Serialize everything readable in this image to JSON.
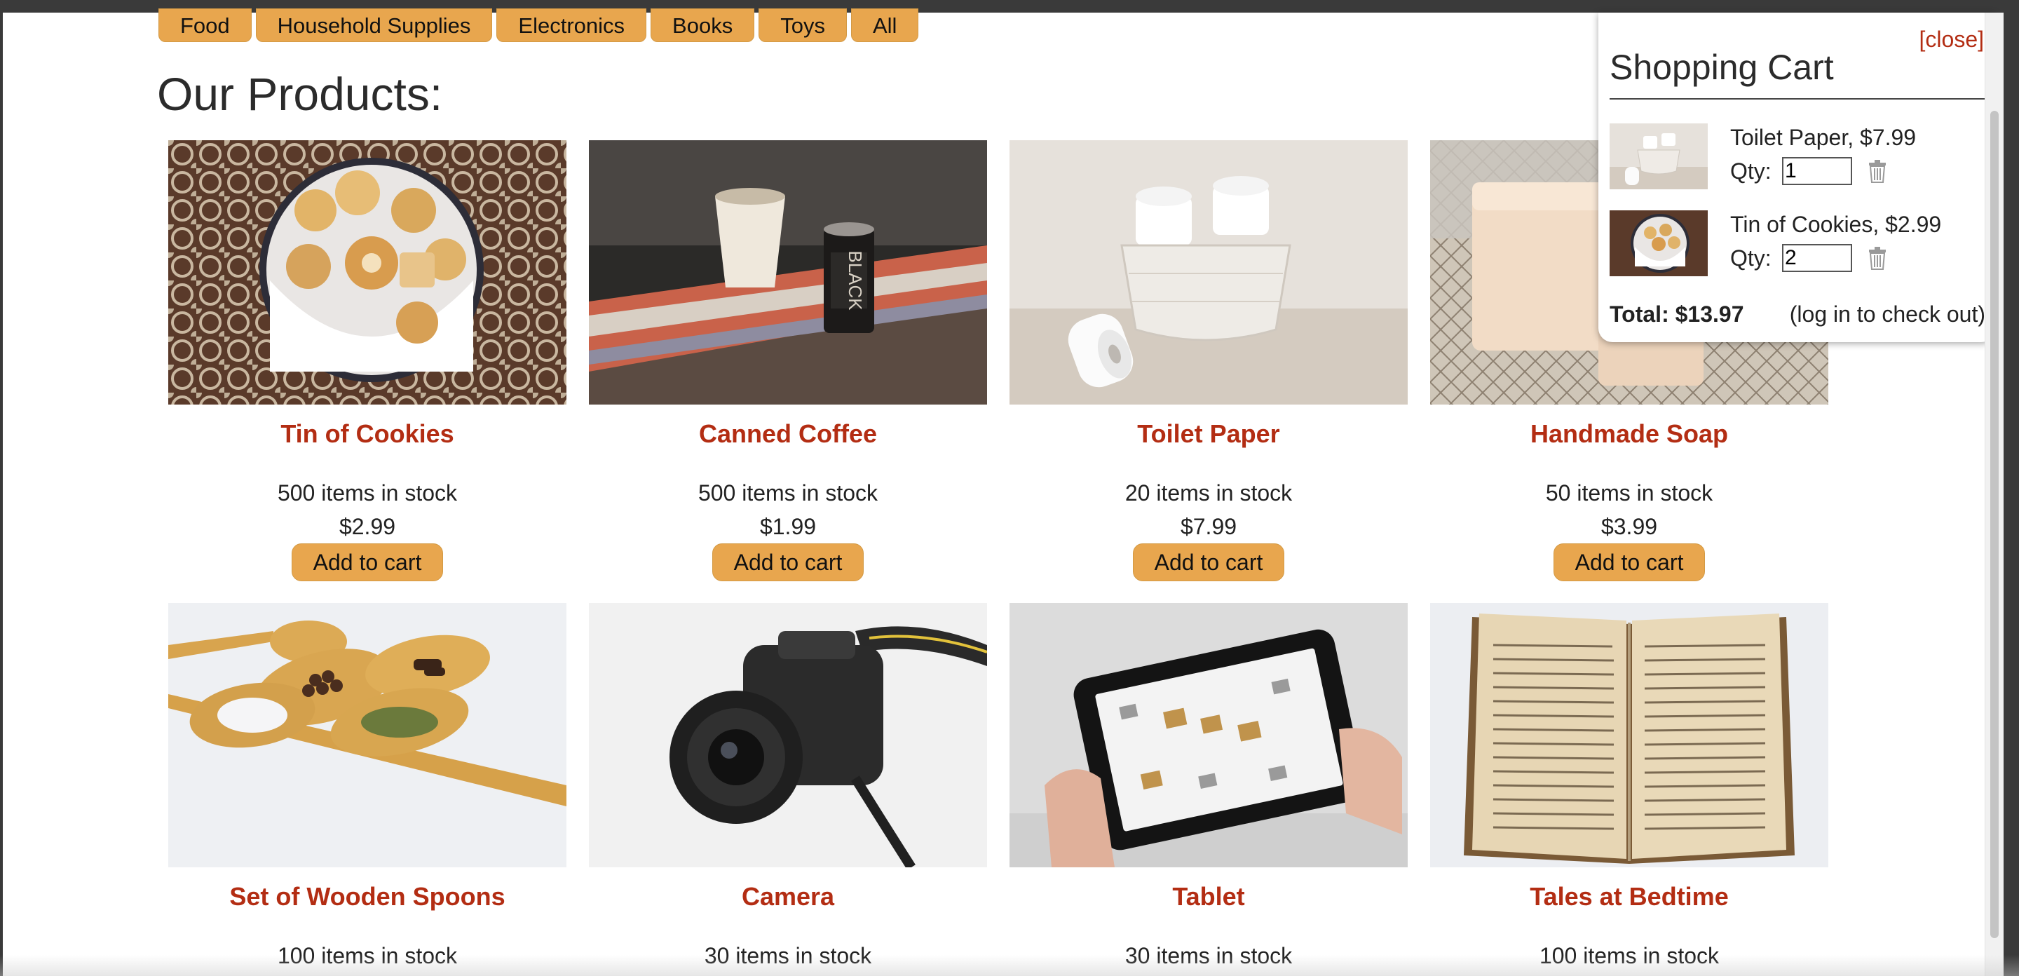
{
  "categories": [
    "Food",
    "Household Supplies",
    "Electronics",
    "Books",
    "Toys",
    "All"
  ],
  "page_title": "Our Products:",
  "products": [
    {
      "name": "Tin of Cookies",
      "stock": "500 items in stock",
      "price": "$2.99",
      "add_label": "Add to cart"
    },
    {
      "name": "Canned Coffee",
      "stock": "500 items in stock",
      "price": "$1.99",
      "add_label": "Add to cart"
    },
    {
      "name": "Toilet Paper",
      "stock": "20 items in stock",
      "price": "$7.99",
      "add_label": "Add to cart"
    },
    {
      "name": "Handmade Soap",
      "stock": "50 items in stock",
      "price": "$3.99",
      "add_label": "Add to cart"
    },
    {
      "name": "Set of Wooden Spoons",
      "stock": "100 items in stock"
    },
    {
      "name": "Camera",
      "stock": "30 items in stock"
    },
    {
      "name": "Tablet",
      "stock": "30 items in stock"
    },
    {
      "name": "Tales at Bedtime",
      "stock": "100 items in stock"
    }
  ],
  "cart": {
    "close_label": "[close]",
    "title": "Shopping Cart",
    "items": [
      {
        "label": "Toilet Paper, $7.99",
        "qty_label": "Qty:",
        "qty": "1"
      },
      {
        "label": "Tin of Cookies, $2.99",
        "qty_label": "Qty:",
        "qty": "2"
      }
    ],
    "total": "Total: $13.97",
    "checkout_note": "(log in to check out)"
  },
  "colors": {
    "accent": "#e8a64e",
    "product_name": "#b32d13",
    "close": "#b32d13"
  }
}
